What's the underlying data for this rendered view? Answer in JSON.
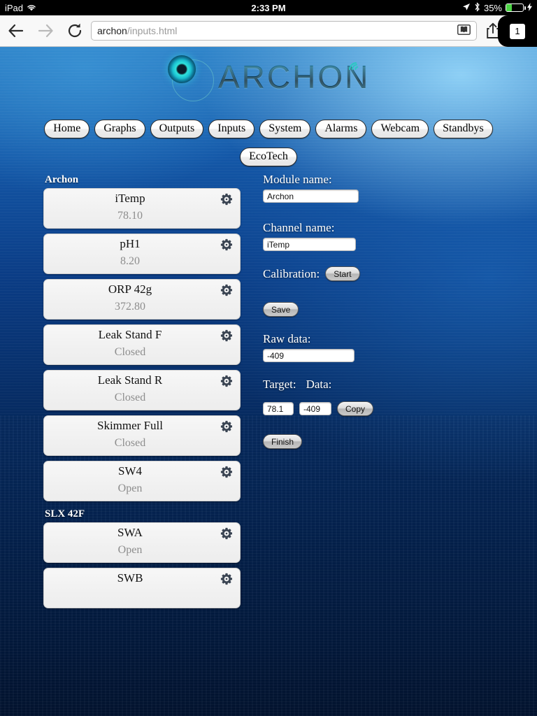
{
  "status_bar": {
    "device": "iPad",
    "wifi_icon": "wifi-icon",
    "time": "2:33 PM",
    "location_icon": "location-arrow-icon",
    "bluetooth_icon": "bluetooth-icon",
    "battery_percent": "35%",
    "battery_level": 35,
    "charging_icon": "lightning-bolt-icon",
    "battery_color": "#4cd445"
  },
  "browser": {
    "back_icon": "back-arrow-icon",
    "forward_icon": "forward-arrow-icon",
    "reload_icon": "reload-icon",
    "url_host": "archon",
    "url_path": "/inputs.html",
    "reader_icon": "reader-view-icon",
    "share_icon": "share-icon",
    "bookmark_icon": "star-icon",
    "tab_count": "1"
  },
  "site": {
    "logo_text": "ARCHON",
    "logo_mark_icon": "archon-orb-icon",
    "logo_signal_icon": "wifi-signal-icon",
    "accent_color": "#1bbfd0",
    "nav_row1": [
      {
        "label": "Home"
      },
      {
        "label": "Graphs"
      },
      {
        "label": "Outputs"
      },
      {
        "label": "Inputs"
      },
      {
        "label": "System"
      },
      {
        "label": "Alarms"
      },
      {
        "label": "Webcam"
      },
      {
        "label": "Standbys"
      }
    ],
    "nav_row2": [
      {
        "label": "EcoTech"
      }
    ]
  },
  "channel_list": {
    "groups": [
      {
        "header": "Archon",
        "items": [
          {
            "name": "iTemp",
            "value": "78.10",
            "gear_icon": "gear-icon"
          },
          {
            "name": "pH1",
            "value": "8.20",
            "gear_icon": "gear-icon"
          },
          {
            "name": "ORP 42g",
            "value": "372.80",
            "gear_icon": "gear-icon"
          },
          {
            "name": "Leak Stand F",
            "value": "Closed",
            "gear_icon": "gear-icon"
          },
          {
            "name": "Leak Stand R",
            "value": "Closed",
            "gear_icon": "gear-icon"
          },
          {
            "name": "Skimmer Full",
            "value": "Closed",
            "gear_icon": "gear-icon"
          },
          {
            "name": "SW4",
            "value": "Open",
            "gear_icon": "gear-icon"
          }
        ]
      },
      {
        "header": "SLX 42F",
        "items": [
          {
            "name": "SWA",
            "value": "Open",
            "gear_icon": "gear-icon"
          },
          {
            "name": "SWB",
            "value": "",
            "gear_icon": "gear-icon"
          }
        ]
      }
    ]
  },
  "form": {
    "module_label": "Module name:",
    "module_value": "Archon",
    "channel_label": "Channel name:",
    "channel_value": "iTemp",
    "calibration_label": "Calibration:",
    "start_button": "Start",
    "save_button": "Save",
    "raw_data_label": "Raw data:",
    "raw_data_value": "-409",
    "target_label": "Target:",
    "data_label": "Data:",
    "target_value": "78.1",
    "data_value": "-409",
    "copy_button": "Copy",
    "finish_button": "Finish"
  }
}
